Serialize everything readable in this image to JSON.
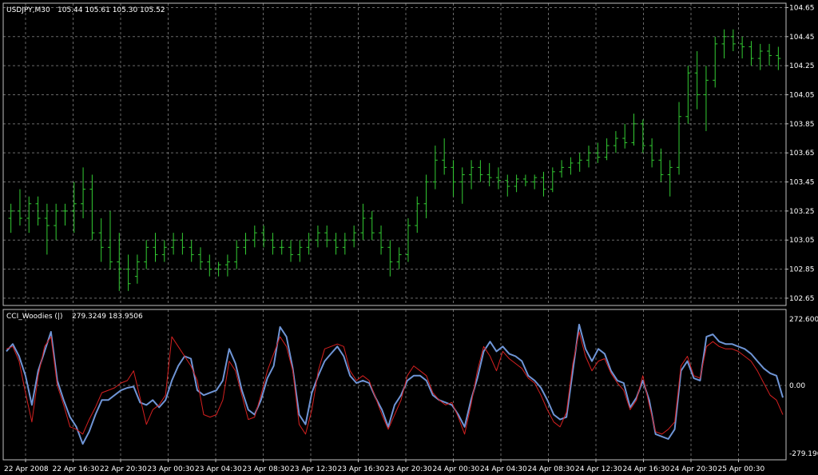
{
  "price_panel": {
    "title": "USDJPY,M30",
    "ohlc": "105.44 105.61 105.30 105.52",
    "price_ticks": [
      "104.65",
      "104.45",
      "104.25",
      "104.05",
      "103.85",
      "103.65",
      "103.45",
      "103.25",
      "103.05",
      "102.85",
      "102.65"
    ]
  },
  "indicator_panel": {
    "title": "CCI_Woodies (|)",
    "values": "279.3249 183.9506",
    "scale_max": "272.6009",
    "scale_zero": "0.00",
    "scale_min": "-279.196"
  },
  "time_labels": [
    "22 Apr 2008",
    "22 Apr 16:30",
    "22 Apr 20:30",
    "23 Apr 00:30",
    "23 Apr 04:30",
    "23 Apr 08:30",
    "23 Apr 12:30",
    "23 Apr 16:30",
    "23 Apr 20:30",
    "24 Apr 00:30",
    "24 Apr 04:30",
    "24 Apr 08:30",
    "24 Apr 12:30",
    "24 Apr 16:30",
    "24 Apr 20:30",
    "25 Apr 00:30"
  ],
  "colors": {
    "background": "#000000",
    "grid": "#c0c0c0",
    "bars": "#33cc33",
    "cci_blue": "#6f95d6",
    "cci_red": "#d42020",
    "frame": "#c0c0c0",
    "text": "#ffffff"
  },
  "chart_data": [
    {
      "type": "ohlc",
      "symbol": "USDJPY",
      "timeframe": "M30",
      "ylim": [
        102.6,
        104.68
      ],
      "ohlc_last": [
        105.44,
        105.61,
        105.3,
        105.52
      ],
      "bars": [
        [
          103.2,
          103.3,
          103.1,
          103.25
        ],
        [
          103.25,
          103.4,
          103.15,
          103.2
        ],
        [
          103.2,
          103.35,
          103.1,
          103.3
        ],
        [
          103.3,
          103.35,
          103.15,
          103.2
        ],
        [
          103.2,
          103.3,
          102.95,
          103.15
        ],
        [
          103.15,
          103.3,
          103.05,
          103.25
        ],
        [
          103.25,
          103.3,
          103.15,
          103.25
        ],
        [
          103.25,
          103.45,
          103.1,
          103.3
        ],
        [
          103.3,
          103.55,
          103.2,
          103.4
        ],
        [
          103.4,
          103.5,
          103.05,
          103.1
        ],
        [
          103.1,
          103.2,
          102.9,
          103.0
        ],
        [
          103.0,
          103.25,
          102.85,
          102.9
        ],
        [
          102.9,
          103.1,
          102.7,
          102.85
        ],
        [
          102.85,
          102.95,
          102.7,
          102.75
        ],
        [
          102.8,
          102.95,
          102.75,
          102.9
        ],
        [
          102.9,
          103.05,
          102.85,
          103.0
        ],
        [
          103.0,
          103.1,
          102.9,
          102.95
        ],
        [
          102.95,
          103.05,
          102.9,
          103.0
        ],
        [
          103.0,
          103.1,
          102.95,
          103.05
        ],
        [
          103.05,
          103.1,
          102.95,
          103.0
        ],
        [
          103.0,
          103.05,
          102.9,
          102.95
        ],
        [
          102.95,
          103.0,
          102.85,
          102.9
        ],
        [
          102.9,
          102.95,
          102.8,
          102.85
        ],
        [
          102.85,
          102.9,
          102.8,
          102.88
        ],
        [
          102.88,
          102.95,
          102.8,
          102.9
        ],
        [
          102.9,
          103.05,
          102.85,
          103.0
        ],
        [
          103.0,
          103.1,
          102.95,
          103.05
        ],
        [
          103.05,
          103.15,
          103.0,
          103.1
        ],
        [
          103.1,
          103.15,
          103.0,
          103.05
        ],
        [
          103.05,
          103.1,
          102.95,
          103.0
        ],
        [
          103.0,
          103.05,
          102.95,
          103.0
        ],
        [
          103.0,
          103.05,
          102.9,
          102.95
        ],
        [
          102.95,
          103.05,
          102.9,
          103.0
        ],
        [
          103.0,
          103.1,
          102.95,
          103.05
        ],
        [
          103.05,
          103.15,
          103.0,
          103.1
        ],
        [
          103.1,
          103.15,
          103.0,
          103.05
        ],
        [
          103.05,
          103.1,
          102.95,
          103.0
        ],
        [
          103.0,
          103.1,
          102.95,
          103.05
        ],
        [
          103.05,
          103.15,
          103.0,
          103.1
        ],
        [
          103.1,
          103.3,
          103.05,
          103.2
        ],
        [
          103.2,
          103.25,
          103.05,
          103.1
        ],
        [
          103.1,
          103.15,
          102.95,
          103.0
        ],
        [
          103.0,
          103.05,
          102.8,
          102.9
        ],
        [
          102.9,
          103.0,
          102.85,
          102.95
        ],
        [
          102.95,
          103.2,
          102.9,
          103.15
        ],
        [
          103.15,
          103.35,
          103.1,
          103.3
        ],
        [
          103.3,
          103.5,
          103.2,
          103.45
        ],
        [
          103.45,
          103.7,
          103.4,
          103.6
        ],
        [
          103.6,
          103.75,
          103.5,
          103.55
        ],
        [
          103.55,
          103.6,
          103.35,
          103.45
        ],
        [
          103.45,
          103.55,
          103.3,
          103.5
        ],
        [
          103.5,
          103.6,
          103.4,
          103.55
        ],
        [
          103.55,
          103.6,
          103.45,
          103.5
        ],
        [
          103.5,
          103.58,
          103.42,
          103.48
        ],
        [
          103.48,
          103.55,
          103.4,
          103.46
        ],
        [
          103.46,
          103.5,
          103.35,
          103.42
        ],
        [
          103.42,
          103.5,
          103.38,
          103.47
        ],
        [
          103.47,
          103.5,
          103.42,
          103.45
        ],
        [
          103.45,
          103.5,
          103.4,
          103.48
        ],
        [
          103.48,
          103.52,
          103.35,
          103.4
        ],
        [
          103.4,
          103.55,
          103.38,
          103.52
        ],
        [
          103.52,
          103.6,
          103.48,
          103.55
        ],
        [
          103.55,
          103.62,
          103.5,
          103.58
        ],
        [
          103.58,
          103.65,
          103.52,
          103.6
        ],
        [
          103.6,
          103.7,
          103.55,
          103.65
        ],
        [
          103.65,
          103.72,
          103.58,
          103.62
        ],
        [
          103.62,
          103.75,
          103.6,
          103.7
        ],
        [
          103.7,
          103.8,
          103.65,
          103.75
        ],
        [
          103.75,
          103.85,
          103.68,
          103.72
        ],
        [
          103.72,
          103.92,
          103.7,
          103.85
        ],
        [
          103.85,
          103.88,
          103.65,
          103.7
        ],
        [
          103.7,
          103.75,
          103.55,
          103.6
        ],
        [
          103.6,
          103.68,
          103.45,
          103.5
        ],
        [
          103.5,
          103.6,
          103.35,
          103.55
        ],
        [
          103.55,
          104.0,
          103.5,
          103.9
        ],
        [
          103.9,
          104.25,
          103.85,
          104.2
        ],
        [
          104.2,
          104.35,
          103.95,
          104.05
        ],
        [
          104.05,
          104.25,
          103.8,
          104.15
        ],
        [
          104.15,
          104.45,
          104.1,
          104.4
        ],
        [
          104.4,
          104.5,
          104.3,
          104.45
        ],
        [
          104.45,
          104.5,
          104.35,
          104.4
        ],
        [
          104.4,
          104.45,
          104.3,
          104.38
        ],
        [
          104.38,
          104.42,
          104.25,
          104.3
        ],
        [
          104.3,
          104.4,
          104.22,
          104.35
        ],
        [
          104.35,
          104.4,
          104.25,
          104.32
        ],
        [
          104.32,
          104.38,
          104.22,
          104.3
        ]
      ]
    },
    {
      "type": "line",
      "title": "CCI_Woodies (|)",
      "ylim": [
        -279.196,
        272.6009
      ],
      "series": [
        {
          "name": "CCI",
          "values": [
            140,
            170,
            120,
            40,
            -80,
            60,
            140,
            220,
            20,
            -60,
            -130,
            -170,
            -240,
            -190,
            -120,
            -60,
            -60,
            -40,
            -20,
            -10,
            -5,
            -70,
            -80,
            -60,
            -90,
            -60,
            20,
            80,
            120,
            110,
            -20,
            -40,
            -30,
            -20,
            20,
            150,
            90,
            -20,
            -100,
            -120,
            -60,
            30,
            80,
            240,
            200,
            70,
            -120,
            -160,
            -30,
            40,
            100,
            130,
            160,
            120,
            40,
            10,
            20,
            10,
            -50,
            -100,
            -170,
            -80,
            -40,
            20,
            40,
            40,
            20,
            -40,
            -60,
            -70,
            -80,
            -120,
            -170,
            -60,
            30,
            140,
            180,
            140,
            160,
            130,
            120,
            100,
            40,
            20,
            -10,
            -60,
            -120,
            -140,
            -130,
            60,
            250,
            150,
            100,
            150,
            130,
            60,
            20,
            10,
            -90,
            -50,
            20,
            -60,
            -200,
            -210,
            -220,
            -180,
            60,
            100,
            30,
            20,
            200,
            210,
            180,
            170,
            170,
            160,
            150,
            130,
            100,
            70,
            50,
            40,
            -50
          ]
        },
        {
          "name": "TCCI",
          "values": [
            150,
            160,
            100,
            -30,
            -150,
            40,
            160,
            200,
            0,
            -80,
            -170,
            -180,
            -200,
            -140,
            -90,
            -30,
            -20,
            -10,
            10,
            20,
            60,
            -50,
            -160,
            -100,
            -80,
            -40,
            200,
            160,
            120,
            80,
            20,
            -120,
            -130,
            -120,
            -60,
            100,
            60,
            -40,
            -140,
            -130,
            -40,
            60,
            130,
            200,
            160,
            60,
            -160,
            -200,
            -100,
            60,
            150,
            160,
            170,
            160,
            60,
            20,
            40,
            20,
            -50,
            -120,
            -180,
            -120,
            -60,
            40,
            80,
            60,
            40,
            -30,
            -60,
            -80,
            -70,
            -130,
            -200,
            -80,
            60,
            160,
            120,
            60,
            140,
            110,
            90,
            70,
            30,
            10,
            -40,
            -100,
            -150,
            -170,
            -110,
            90,
            220,
            120,
            60,
            100,
            110,
            50,
            10,
            -20,
            -100,
            -60,
            40,
            -80,
            -190,
            -200,
            -180,
            -150,
            80,
            120,
            40,
            30,
            160,
            180,
            160,
            150,
            150,
            140,
            120,
            100,
            60,
            10,
            -40,
            -60,
            -120
          ]
        }
      ]
    }
  ]
}
